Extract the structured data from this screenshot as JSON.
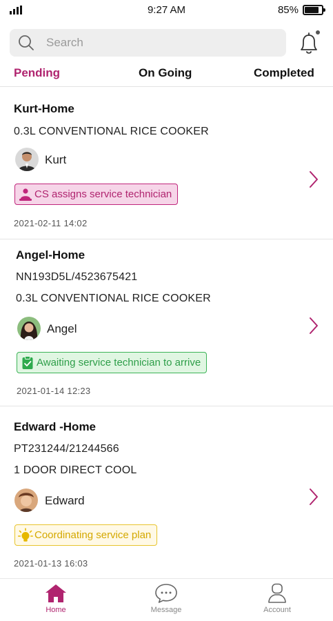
{
  "status_bar": {
    "time": "9:27 AM",
    "battery": "85%",
    "battery_level": 0.85
  },
  "search": {
    "placeholder": "Search"
  },
  "tabs": [
    {
      "label": "Pending",
      "active": true
    },
    {
      "label": "On Going",
      "active": false
    },
    {
      "label": "Completed",
      "active": false
    }
  ],
  "orders": [
    {
      "title": "Kurt-Home",
      "lines": [
        "0.3L CONVENTIONAL RICE COOKER"
      ],
      "user": "Kurt",
      "status": "CS assigns service technician",
      "status_icon": "technician-icon",
      "status_color": "#b0246f",
      "date": "2021-02-11  14:02"
    },
    {
      "title": "Angel-Home",
      "lines": [
        "NN193D5L/4523675421",
        "0.3L CONVENTIONAL RICE COOKER"
      ],
      "user": "Angel",
      "status": "Awaiting service technician to arrive",
      "status_icon": "clipboard-check-icon",
      "status_color": "#2e9e49",
      "date": "2021-01-14  12:23"
    },
    {
      "title": "Edward -Home",
      "lines": [
        "PT231244/21244566",
        "1 DOOR DIRECT COOL"
      ],
      "user": "Edward",
      "status": "Coordinating service plan",
      "status_icon": "lightbulb-icon",
      "status_color": "#d4a800",
      "date": "2021-01-13  16:03"
    }
  ],
  "bottom_nav": [
    {
      "label": "Home",
      "icon": "home-icon",
      "active": true
    },
    {
      "label": "Message",
      "icon": "chat-bubble-icon",
      "active": false
    },
    {
      "label": "Account",
      "icon": "user-icon",
      "active": false
    }
  ],
  "colors": {
    "accent": "#b0246f",
    "green": "#2e9e49",
    "yellow": "#d4a800"
  }
}
